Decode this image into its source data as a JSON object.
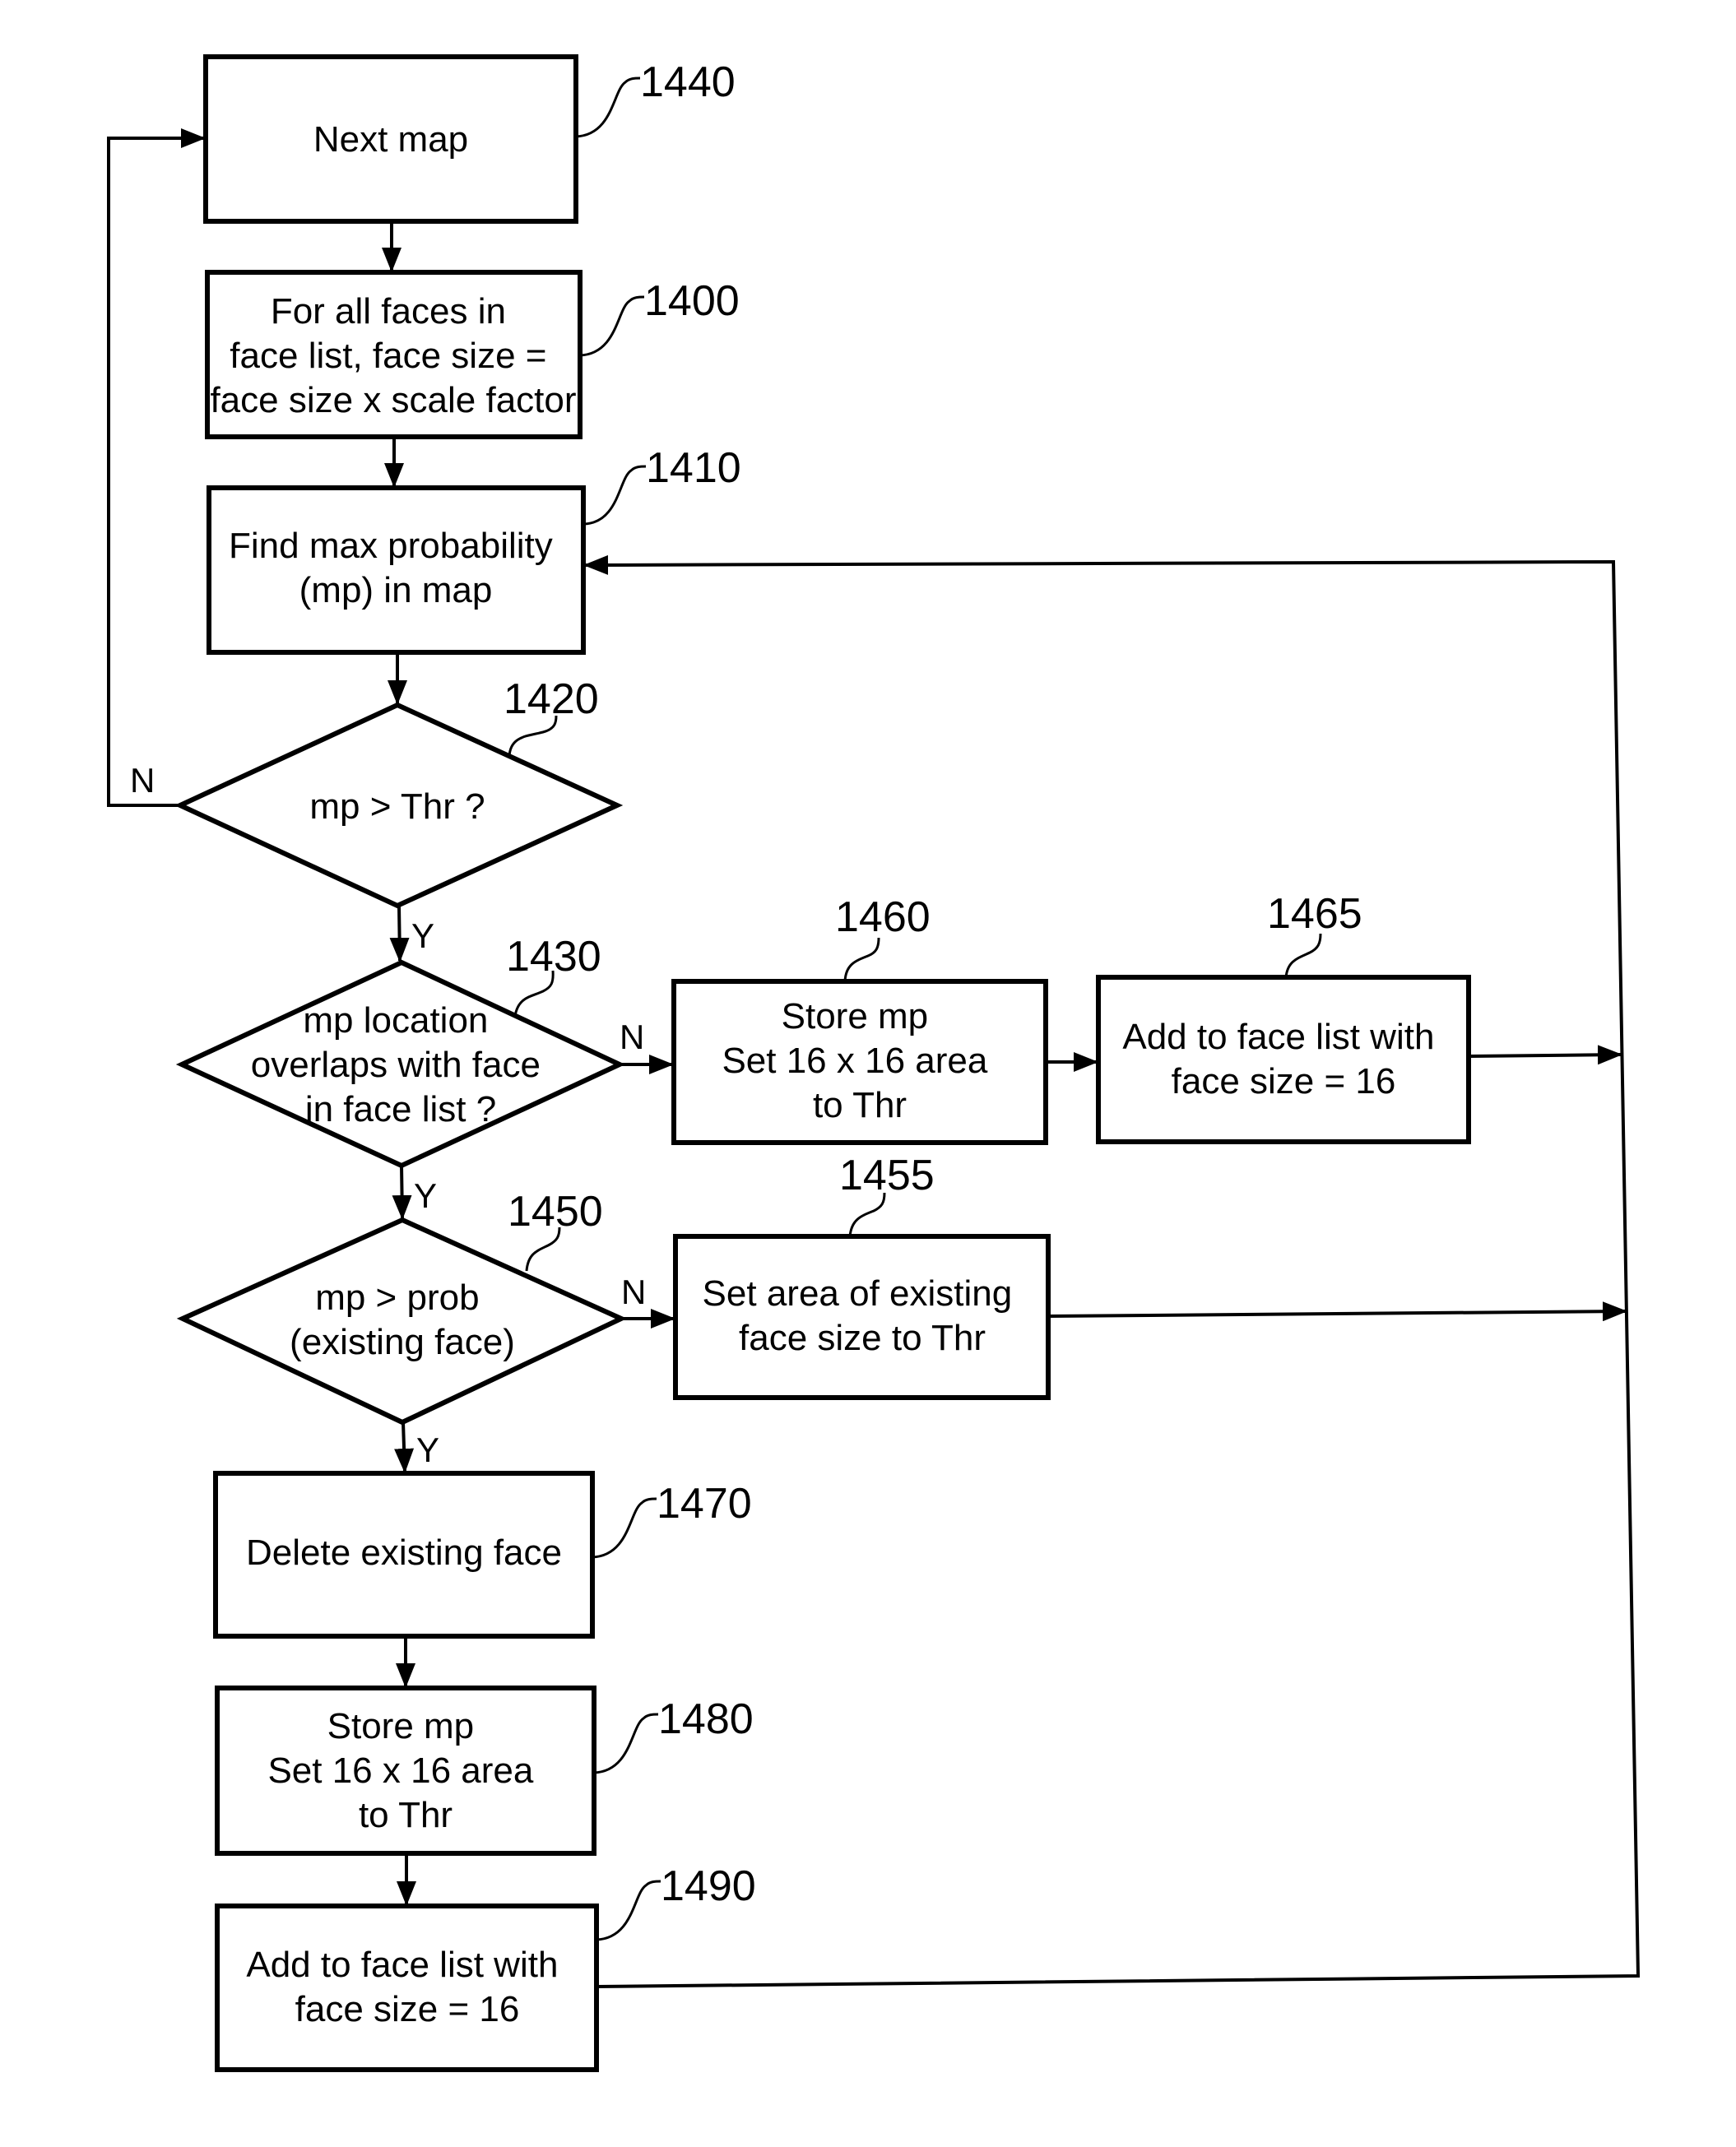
{
  "diagram": {
    "nodes": {
      "n1440": {
        "ref": "1440",
        "lines": [
          "Next map"
        ]
      },
      "n1400": {
        "ref": "1400",
        "lines": [
          "For all faces in",
          "face list, face size =",
          "face size x scale factor"
        ]
      },
      "n1410": {
        "ref": "1410",
        "lines": [
          "Find max probability",
          "(mp) in map"
        ]
      },
      "n1420": {
        "ref": "1420",
        "lines": [
          "mp > Thr ?"
        ]
      },
      "n1430": {
        "ref": "1430",
        "lines": [
          "mp location",
          "overlaps with face",
          "in face list ?"
        ]
      },
      "n1460": {
        "ref": "1460",
        "lines": [
          "Store mp",
          "Set 16 x 16 area",
          "to Thr"
        ]
      },
      "n1465": {
        "ref": "1465",
        "lines": [
          "Add to face list with",
          "face size = 16"
        ]
      },
      "n1450": {
        "ref": "1450",
        "lines": [
          "mp > prob",
          "(existing face)"
        ]
      },
      "n1455": {
        "ref": "1455",
        "lines": [
          "Set area of existing",
          "face size to Thr"
        ]
      },
      "n1470": {
        "ref": "1470",
        "lines": [
          "Delete existing face"
        ]
      },
      "n1480": {
        "ref": "1480",
        "lines": [
          "Store mp",
          "Set 16 x 16 area",
          "to Thr"
        ]
      },
      "n1490": {
        "ref": "1490",
        "lines": [
          "Add to face list with",
          "face size = 16"
        ]
      }
    },
    "branch_labels": {
      "yes": "Y",
      "no": "N"
    }
  }
}
